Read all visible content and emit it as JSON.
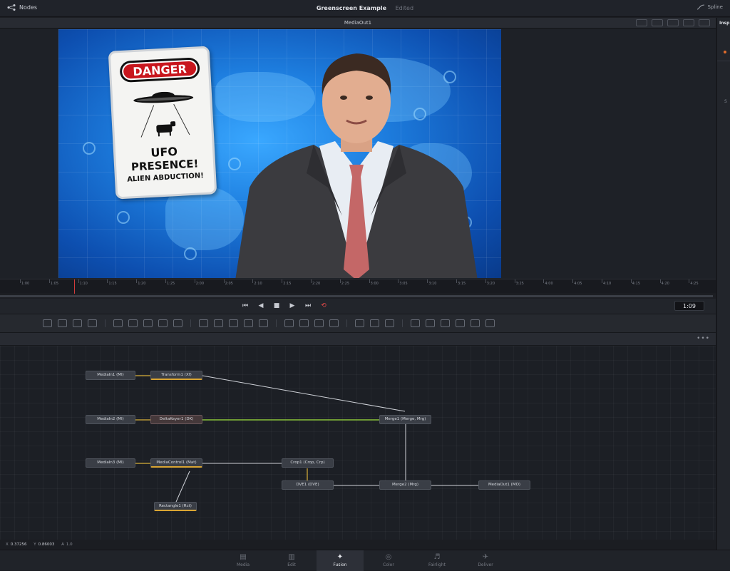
{
  "topbar": {
    "nodes_label": "Nodes",
    "project_title": "Greenscreen Example",
    "project_status": "Edited",
    "spline_label": "Spline"
  },
  "viewer": {
    "name": "MediaOut1",
    "sign": {
      "danger": "DANGER",
      "line1": "UFO",
      "line2": "PRESENCE!",
      "line3": "ALIEN ABDUCTION!"
    }
  },
  "timeline": {
    "ticks": [
      "1:00",
      "1:05",
      "1:10",
      "1:15",
      "1:20",
      "1:25",
      "2:00",
      "2:05",
      "2:10",
      "2:15",
      "2:20",
      "2:25",
      "3:00",
      "3:05",
      "3:10",
      "3:15",
      "3:20",
      "3:25",
      "4:00",
      "4:05",
      "4:10",
      "4:15",
      "4:20",
      "4:25"
    ],
    "timecode": "1:09"
  },
  "transport": {
    "first": "⏮",
    "prev": "◀",
    "stop": "■",
    "play": "▶",
    "last": "⏭",
    "loop": "⟲"
  },
  "nodes": [
    {
      "id": "media1",
      "label": "MediaIn1 (MI)"
    },
    {
      "id": "transform1",
      "label": "Transform1 (Xf)"
    },
    {
      "id": "media2",
      "label": "MediaIn2 (MI)"
    },
    {
      "id": "deltakeyer1",
      "label": "DeltaKeyer1 (DK)"
    },
    {
      "id": "merge1",
      "label": "Merge1 (Merge, Mrg)"
    },
    {
      "id": "media3",
      "label": "MediaIn3 (MI)"
    },
    {
      "id": "mediacontrol1",
      "label": "MediaControl1 (Mat)"
    },
    {
      "id": "crop1",
      "label": "Crop1 (Crop, Crp)"
    },
    {
      "id": "dve1",
      "label": "DVE1 (DVE)"
    },
    {
      "id": "merge2",
      "label": "Merge2 (Mrg)"
    },
    {
      "id": "mediaout1",
      "label": "MediaOut1 (MO)"
    },
    {
      "id": "rectangle1",
      "label": "Rectangle1 (Rct)"
    }
  ],
  "status": {
    "x": "0.37256",
    "y": "0.86003",
    "a": "1.0"
  },
  "pages": [
    {
      "label": "Media",
      "icon": "▤"
    },
    {
      "label": "Edit",
      "icon": "▥"
    },
    {
      "label": "Fusion",
      "icon": "✦",
      "active": true
    },
    {
      "label": "Color",
      "icon": "◎"
    },
    {
      "label": "Fairlight",
      "icon": "♬"
    },
    {
      "label": "Deliver",
      "icon": "✈"
    }
  ],
  "inspector": {
    "label": "Insp",
    "s": "S"
  },
  "colors": {
    "accent_loop": "#e24848",
    "green_wire": "#8ac43a",
    "yellow_wire": "#d9b13a",
    "selected_outline": "#d9a533"
  }
}
